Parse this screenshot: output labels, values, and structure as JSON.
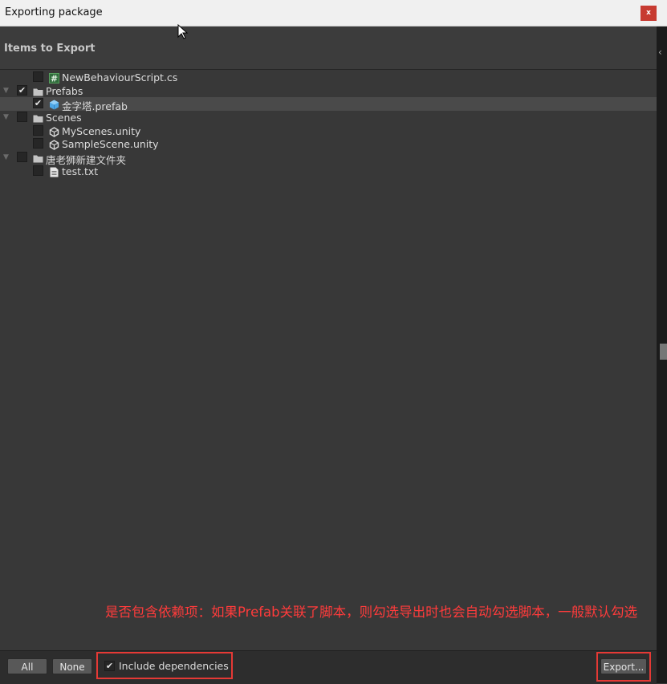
{
  "window": {
    "title": "Exporting package",
    "close_label": "x"
  },
  "header": {
    "label": "Items to Export"
  },
  "tree": [
    {
      "label": "NewBehaviourScript.cs",
      "icon": "csharp-script-icon",
      "depth": 1,
      "checked": false,
      "expandable": false,
      "selected": false
    },
    {
      "label": "Prefabs",
      "icon": "folder-icon",
      "depth": 0,
      "checked": true,
      "expandable": true,
      "selected": false
    },
    {
      "label": "金字塔.prefab",
      "icon": "prefab-icon",
      "depth": 1,
      "checked": true,
      "expandable": false,
      "selected": true
    },
    {
      "label": "Scenes",
      "icon": "folder-icon",
      "depth": 0,
      "checked": false,
      "expandable": true,
      "selected": false
    },
    {
      "label": "MyScenes.unity",
      "icon": "unity-scene-icon",
      "depth": 1,
      "checked": false,
      "expandable": false,
      "selected": false
    },
    {
      "label": "SampleScene.unity",
      "icon": "unity-scene-icon",
      "depth": 1,
      "checked": false,
      "expandable": false,
      "selected": false
    },
    {
      "label": "唐老狮新建文件夹",
      "icon": "folder-icon",
      "depth": 0,
      "checked": false,
      "expandable": true,
      "selected": false
    },
    {
      "label": "test.txt",
      "icon": "text-file-icon",
      "depth": 1,
      "checked": false,
      "expandable": false,
      "selected": false
    }
  ],
  "annotation": {
    "text": "是否包含依赖项：如果Prefab关联了脚本，则勾选导出时也会自动勾选脚本，一般默认勾选"
  },
  "footer": {
    "all_label": "All",
    "none_label": "None",
    "include_dependencies_label": "Include dependencies",
    "include_dependencies_checked": true,
    "export_label": "Export..."
  },
  "colors": {
    "annotation_red": "#e53935",
    "close_red": "#c73b31",
    "selection": "#4a4a4a"
  }
}
